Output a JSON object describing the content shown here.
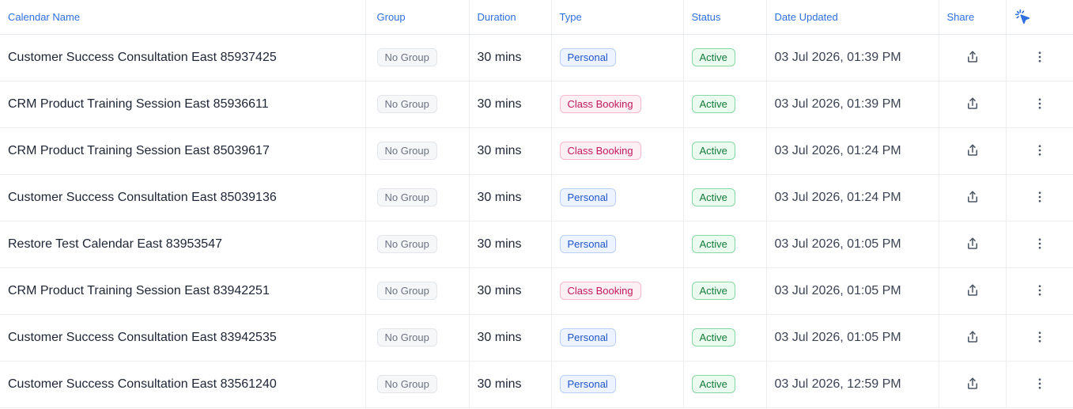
{
  "table": {
    "headers": {
      "name": "Calendar Name",
      "group": "Group",
      "duration": "Duration",
      "type": "Type",
      "status": "Status",
      "date": "Date Updated",
      "share": "Share",
      "columns_icon": "cursor-click-icon"
    },
    "rows": [
      {
        "name": "Customer Success Consultation East 85937425",
        "group": "No Group",
        "duration": "30 mins",
        "type": "Personal",
        "status": "Active",
        "date": "03 Jul 2026, 01:39 PM"
      },
      {
        "name": "CRM Product Training Session East 85936611",
        "group": "No Group",
        "duration": "30 mins",
        "type": "Class Booking",
        "status": "Active",
        "date": "03 Jul 2026, 01:39 PM"
      },
      {
        "name": "CRM Product Training Session East 85039617",
        "group": "No Group",
        "duration": "30 mins",
        "type": "Class Booking",
        "status": "Active",
        "date": "03 Jul 2026, 01:24 PM"
      },
      {
        "name": "Customer Success Consultation East 85039136",
        "group": "No Group",
        "duration": "30 mins",
        "type": "Personal",
        "status": "Active",
        "date": "03 Jul 2026, 01:24 PM"
      },
      {
        "name": "Restore Test Calendar East 83953547",
        "group": "No Group",
        "duration": "30 mins",
        "type": "Personal",
        "status": "Active",
        "date": "03 Jul 2026, 01:05 PM"
      },
      {
        "name": "CRM Product Training Session East 83942251",
        "group": "No Group",
        "duration": "30 mins",
        "type": "Class Booking",
        "status": "Active",
        "date": "03 Jul 2026, 01:05 PM"
      },
      {
        "name": "Customer Success Consultation East 83942535",
        "group": "No Group",
        "duration": "30 mins",
        "type": "Personal",
        "status": "Active",
        "date": "03 Jul 2026, 01:05 PM"
      },
      {
        "name": "Customer Success Consultation East 83561240",
        "group": "No Group",
        "duration": "30 mins",
        "type": "Personal",
        "status": "Active",
        "date": "03 Jul 2026, 12:59 PM"
      }
    ]
  },
  "colors": {
    "header_text": "#2f6fe0",
    "personal": "#1e55c8",
    "class_booking": "#c2185b",
    "active": "#137a3a"
  },
  "icons": {
    "share": "share-icon",
    "more": "more-vertical-icon"
  }
}
